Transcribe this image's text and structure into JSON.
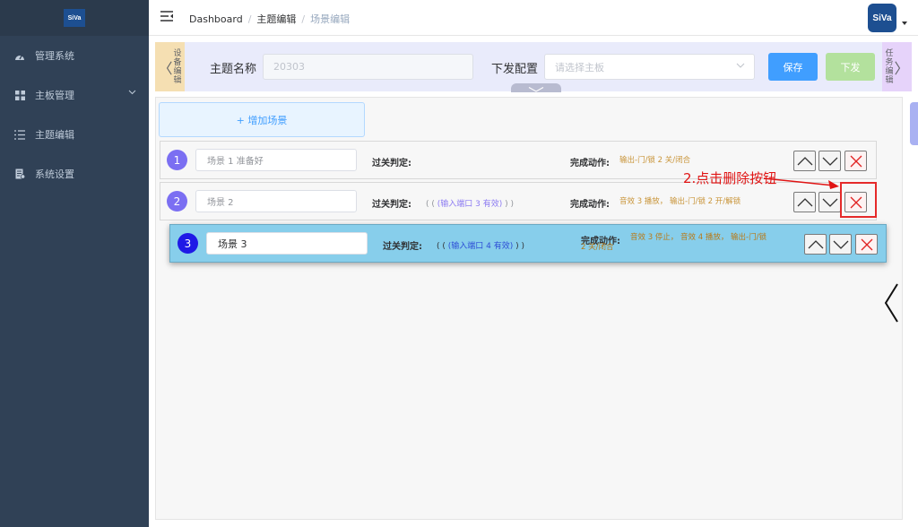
{
  "sidebar": {
    "logo": "SiVa",
    "items": [
      {
        "label": "管理系统",
        "icon": "dashboard-icon"
      },
      {
        "label": "主板管理",
        "icon": "grid-icon"
      },
      {
        "label": "主题编辑",
        "icon": "list-icon"
      },
      {
        "label": "系统设置",
        "icon": "settings-icon"
      }
    ]
  },
  "header": {
    "breadcrumb": [
      "Dashboard",
      "主题编辑",
      "场景编辑"
    ],
    "avatar_text": "SiVa"
  },
  "config": {
    "left_tab": "设备编辑",
    "right_tab": "任务编辑",
    "theme_name_label": "主题名称",
    "theme_name_value": "20303",
    "dispatch_label": "下发配置",
    "board_placeholder": "请选择主板",
    "save_label": "保存",
    "dispatch_button": "下发"
  },
  "main": {
    "add_scene": "+ 增加场景",
    "pass_label": "过关判定:",
    "done_label": "完成动作:",
    "scenes": [
      {
        "index": "1",
        "name": "场景 1 准备好",
        "condition_pre": "",
        "condition_port": "",
        "condition_post": "",
        "action": "输出-门/锁 2 关/闭合"
      },
      {
        "index": "2",
        "name": "场景 2",
        "condition_pre": "( ( ",
        "condition_port": "(输入端口 3 有效)",
        "condition_post": " ) )",
        "action": "音效 3 播放， 输出-门/锁 2 开/解锁"
      },
      {
        "index": "3",
        "name": "场景 3",
        "condition_pre": "( ( ",
        "condition_port": "(输入端口 4 有效)",
        "condition_post": " ) )",
        "action": "音效 3 停止， 音效 4 播放， 输出-门/锁 2 关/闭合"
      }
    ]
  },
  "annotation": "2.点击删除按钮",
  "colors": {
    "save": "#409eff",
    "dispatch": "#b3e19d",
    "highlight": "#e52a2a"
  }
}
